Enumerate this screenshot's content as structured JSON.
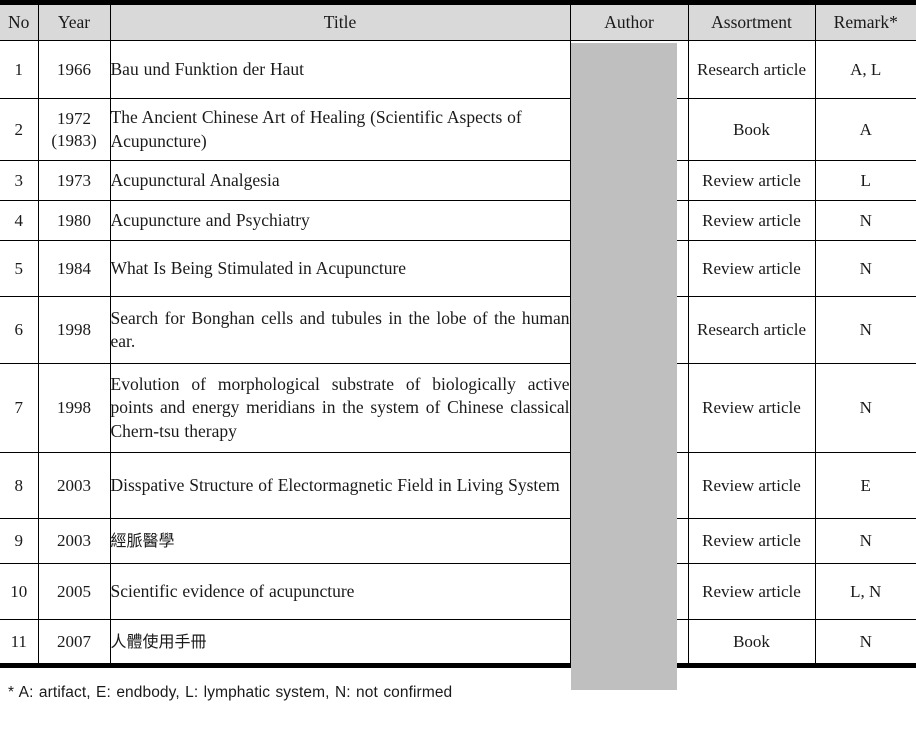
{
  "table": {
    "columns": [
      {
        "key": "no",
        "label": "No"
      },
      {
        "key": "year",
        "label": "Year"
      },
      {
        "key": "title",
        "label": "Title"
      },
      {
        "key": "author",
        "label": "Author"
      },
      {
        "key": "assortment",
        "label": "Assortment"
      },
      {
        "key": "remark",
        "label": "Remark*"
      }
    ],
    "rows": [
      {
        "no": "1",
        "year": "1966",
        "year_alt": "",
        "title": "Bau und Funktion der Haut",
        "author": "",
        "assortment": "Research article",
        "remark": "A, L"
      },
      {
        "no": "2",
        "year": "1972",
        "year_alt": "(1983)",
        "title": "The Ancient Chinese Art of Healing (Scientific Aspects of Acupuncture)",
        "title_line1": "The Ancient Chinese Art of Healing",
        "title_line2": "(Scientific Aspects of Acupuncture)",
        "author": "",
        "assortment": "Book",
        "remark": "A"
      },
      {
        "no": "3",
        "year": "1973",
        "year_alt": "",
        "title": "Acupunctural Analgesia",
        "author": "",
        "assortment": "Review article",
        "remark": "L"
      },
      {
        "no": "4",
        "year": "1980",
        "year_alt": "",
        "title": "Acupuncture and Psychiatry",
        "author": "",
        "assortment": "Review article",
        "remark": "N"
      },
      {
        "no": "5",
        "year": "1984",
        "year_alt": "",
        "title": "What Is Being Stimulated in Acupuncture",
        "author": "",
        "assortment": "Review article",
        "remark": "N"
      },
      {
        "no": "6",
        "year": "1998",
        "year_alt": "",
        "title": "Search for Bonghan cells and tubules in the lobe of the human ear.",
        "author": "",
        "assortment": "Research article",
        "remark": "N"
      },
      {
        "no": "7",
        "year": "1998",
        "year_alt": "",
        "title": "Evolution of morphological substrate of biologically active points and energy meridians in the system of Chinese classical Chern-tsu therapy",
        "author": "",
        "assortment": "Review article",
        "remark": "N"
      },
      {
        "no": "8",
        "year": "2003",
        "year_alt": "",
        "title": "Disspative Structure of Electormagnetic Field in Living System",
        "author": "",
        "assortment": "Review article",
        "remark": "E"
      },
      {
        "no": "9",
        "year": "2003",
        "year_alt": "",
        "title": "經脈醫學",
        "title_is_cjk": true,
        "author": "",
        "assortment": "Review article",
        "remark": "N"
      },
      {
        "no": "10",
        "year": "2005",
        "year_alt": "",
        "title": "Scientific evidence of acupuncture",
        "author": "",
        "assortment": "Review article",
        "remark": "L, N"
      },
      {
        "no": "11",
        "year": "2007",
        "year_alt": "",
        "title": "人體使用手冊",
        "title_is_cjk": true,
        "author": "",
        "assortment": "Book",
        "remark": "N"
      }
    ]
  },
  "author_column": {
    "redacted": true,
    "redaction_color": "#bfbfbf"
  },
  "footnote": {
    "text": "* A: artifact, E: endbody, L: lymphatic system, N: not confirmed"
  },
  "colors": {
    "header_background": "#d9d9d9",
    "border": "#000000",
    "text": "#1a1a1a",
    "page_background": "#ffffff"
  }
}
